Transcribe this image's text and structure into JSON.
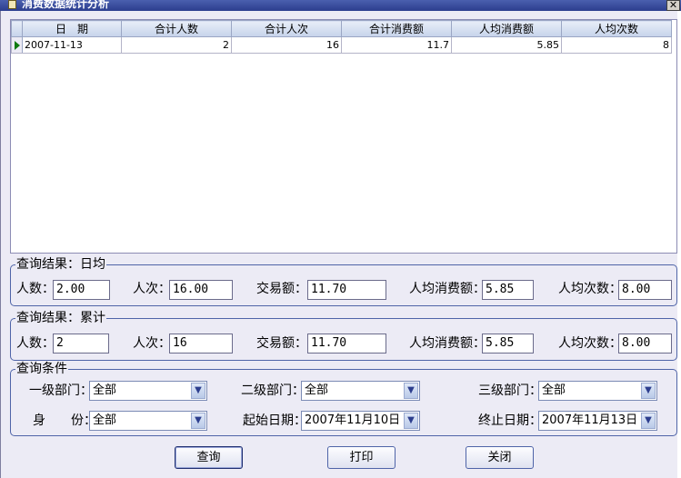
{
  "window": {
    "title": "消费数据统计分析",
    "close_glyph": "✕"
  },
  "grid": {
    "columns": [
      "日　期",
      "合计人数",
      "合计人次",
      "合计消费额",
      "人均消费额",
      "人均次数"
    ],
    "rows": [
      {
        "date": "2007-11-13",
        "total_people": "2",
        "total_visits": "16",
        "total_amount": "11.7",
        "avg_amount": "5.85",
        "avg_visits": "8"
      }
    ]
  },
  "daily": {
    "legend": "查询结果：日均",
    "people_label": "人数：",
    "people_value": "2.00",
    "visits_label": "人次：",
    "visits_value": "16.00",
    "amount_label": "交易额：",
    "amount_value": "11.70",
    "avg_amount_label": "人均消费额：",
    "avg_amount_value": "5.85",
    "avg_visits_label": "人均次数：",
    "avg_visits_value": "8.00"
  },
  "cumulative": {
    "legend": "查询结果：累计",
    "people_label": "人数：",
    "people_value": "2",
    "visits_label": "人次：",
    "visits_value": "16",
    "amount_label": "交易额：",
    "amount_value": "11.70",
    "avg_amount_label": "人均消费额：",
    "avg_amount_value": "5.85",
    "avg_visits_label": "人均次数：",
    "avg_visits_value": "8.00"
  },
  "conditions": {
    "legend": "查询条件",
    "dept1_label": "一级部门：",
    "dept1_value": "全部",
    "dept2_label": "二级部门：",
    "dept2_value": "全部",
    "dept3_label": "三级部门：",
    "dept3_value": "全部",
    "identity_label": "身　　份：",
    "identity_value": "全部",
    "start_label": "起始日期：",
    "start_value": "2007年11月10日",
    "end_label": "终止日期：",
    "end_value": "2007年11月13日"
  },
  "buttons": {
    "query": "查询",
    "print": "打印",
    "close": "关闭"
  },
  "icons": {
    "dropdown": "▼"
  }
}
